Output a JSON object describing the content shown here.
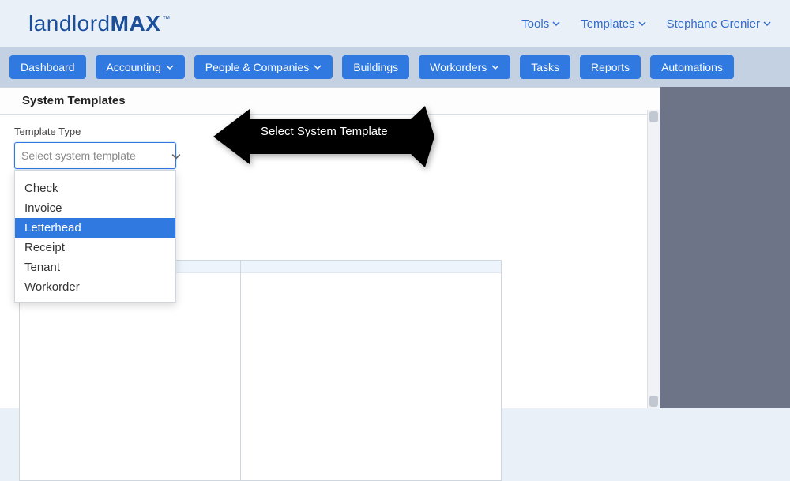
{
  "logo": {
    "part1": "landlord",
    "part2": "MAX",
    "tm": "™"
  },
  "topmenu": [
    {
      "label": "Tools"
    },
    {
      "label": "Templates"
    },
    {
      "label": "Stephane Grenier"
    }
  ],
  "nav": {
    "dashboard": "Dashboard",
    "accounting": "Accounting",
    "people": "People & Companies",
    "buildings": "Buildings",
    "workorders": "Workorders",
    "tasks": "Tasks",
    "reports": "Reports",
    "automations": "Automations"
  },
  "section_title": "System Templates",
  "field": {
    "label": "Template Type",
    "placeholder": "Select system template"
  },
  "options": [
    {
      "label": "Check",
      "selected": false
    },
    {
      "label": "Invoice",
      "selected": false
    },
    {
      "label": "Letterhead",
      "selected": true
    },
    {
      "label": "Receipt",
      "selected": false
    },
    {
      "label": "Tenant",
      "selected": false
    },
    {
      "label": "Workorder",
      "selected": false
    }
  ],
  "callout": {
    "text": "Select System Template"
  }
}
